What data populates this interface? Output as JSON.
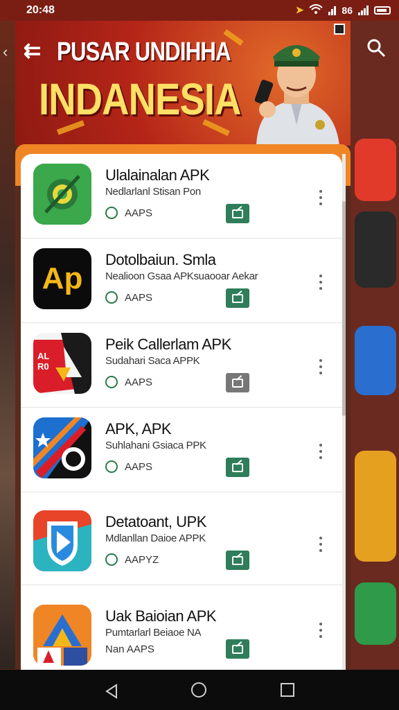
{
  "status_bar": {
    "time": "20:48",
    "extra": "86"
  },
  "banner": {
    "title": "PUSAR UNDIHHA",
    "subtitle": "INDANESIA",
    "back_icon": "back-arrow-icon",
    "search_icon": "search-icon"
  },
  "apps": [
    {
      "name": "Ulalainalan APK",
      "desc": "Nedlarlanl Stisan Pon",
      "tag": "AAPS",
      "icon": "green-circle-logo",
      "button_color": "#2f7d5a"
    },
    {
      "name": "Dotolbaiun. Smla",
      "desc": "Nealioon Gsaa APKsuaooar Aekar",
      "tag": "AAPS",
      "icon": "ap-logo",
      "icon_text": "Ap",
      "button_color": "#2f7d5a"
    },
    {
      "name": "Peik Callerlam APK",
      "desc": "Sudahari Saca APPK",
      "tag": "AAPS",
      "icon": "red-arrow-logo",
      "icon_text": "AL R0",
      "button_color": "#777777"
    },
    {
      "name": "APK, APK",
      "desc": "Suhlahani Gsiaca PPK",
      "tag": "AAPS",
      "icon": "blue-black-split-logo",
      "button_color": "#2f7d5a"
    },
    {
      "name": "Detatoant, UPK",
      "desc": "Mdlanllan Daioe APPK",
      "tag": "AAPYZ",
      "icon": "play-shield-logo",
      "button_color": "#2f7d5a"
    },
    {
      "name": "Uak Baioian APK",
      "desc": "Pumtarlarl Beiaoe NA",
      "tag": "Nan AAPS",
      "icon": "colorful-triangle-logo",
      "button_color": "#2f7d5a"
    }
  ],
  "colors": {
    "banner_red": "#b52518",
    "accent_orange": "#f08526",
    "install_green": "#2f7d5a"
  }
}
